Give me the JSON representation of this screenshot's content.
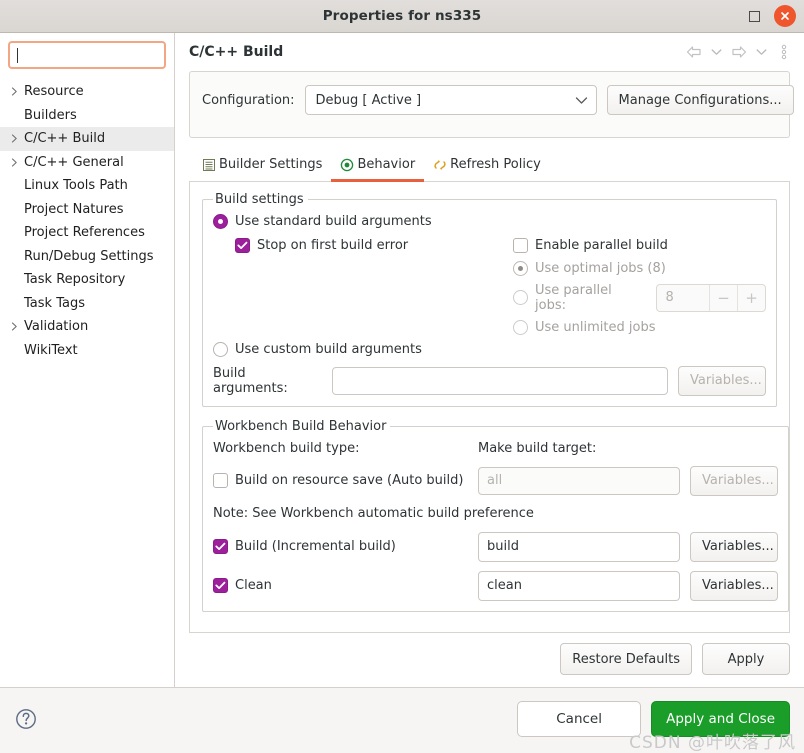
{
  "window": {
    "title": "Properties for ns335",
    "maximize_icon": "maximize-icon",
    "close_icon": "close-icon"
  },
  "sidebar": {
    "filter": {
      "value": "",
      "placeholder": ""
    },
    "items": [
      {
        "label": "Resource",
        "expandable": true,
        "selected": false
      },
      {
        "label": "Builders",
        "expandable": false,
        "selected": false
      },
      {
        "label": "C/C++ Build",
        "expandable": true,
        "selected": true
      },
      {
        "label": "C/C++ General",
        "expandable": true,
        "selected": false
      },
      {
        "label": "Linux Tools Path",
        "expandable": false,
        "selected": false
      },
      {
        "label": "Project Natures",
        "expandable": false,
        "selected": false
      },
      {
        "label": "Project References",
        "expandable": false,
        "selected": false
      },
      {
        "label": "Run/Debug Settings",
        "expandable": false,
        "selected": false
      },
      {
        "label": "Task Repository",
        "expandable": false,
        "selected": false
      },
      {
        "label": "Task Tags",
        "expandable": false,
        "selected": false
      },
      {
        "label": "Validation",
        "expandable": true,
        "selected": false
      },
      {
        "label": "WikiText",
        "expandable": false,
        "selected": false
      }
    ]
  },
  "header": {
    "title": "C/C++ Build",
    "tools": [
      "back-arrow-icon",
      "back-dropdown-chevron-icon",
      "forward-arrow-icon",
      "forward-dropdown-chevron-icon",
      "view-menu-icon"
    ]
  },
  "configuration": {
    "label": "Configuration:",
    "value": "Debug  [ Active ]",
    "manage_button": "Manage Configurations..."
  },
  "tabs": [
    {
      "label": "Builder Settings",
      "icon": "builder-settings-icon",
      "active": false
    },
    {
      "label": "Behavior",
      "icon": "behavior-icon",
      "active": true
    },
    {
      "label": "Refresh Policy",
      "icon": "refresh-policy-icon",
      "active": false
    }
  ],
  "build_settings": {
    "legend": "Build settings",
    "use_standard": {
      "label": "Use standard build arguments",
      "checked": true
    },
    "stop_on_first_error": {
      "label": "Stop on first build error",
      "checked": true
    },
    "enable_parallel": {
      "label": "Enable parallel build",
      "checked": false
    },
    "optimal_jobs": {
      "label": "Use optimal jobs (8)",
      "checked": true,
      "disabled": true
    },
    "parallel_jobs": {
      "label": "Use parallel jobs:",
      "checked": false,
      "disabled": true,
      "value": "8",
      "minus": "−",
      "plus": "+"
    },
    "unlimited_jobs": {
      "label": "Use unlimited jobs",
      "checked": false,
      "disabled": true
    },
    "use_custom": {
      "label": "Use custom build arguments",
      "checked": false
    },
    "build_arguments": {
      "label": "Build arguments:",
      "value": "",
      "variables_button": "Variables..."
    }
  },
  "workbench": {
    "legend": "Workbench Build Behavior",
    "build_type_label": "Workbench build type:",
    "make_target_label": "Make build target:",
    "rows": [
      {
        "label": "Build on resource save (Auto build)",
        "checked": false,
        "target": "",
        "target_placeholder": "all",
        "variables_button": "Variables...",
        "disabled": true
      },
      {
        "label": "Build (Incremental build)",
        "checked": true,
        "target": "build",
        "target_placeholder": "",
        "variables_button": "Variables...",
        "disabled": false
      },
      {
        "label": "Clean",
        "checked": true,
        "target": "clean",
        "target_placeholder": "",
        "variables_button": "Variables...",
        "disabled": false
      }
    ],
    "note": "Note: See Workbench automatic build preference"
  },
  "page_buttons": {
    "restore_defaults": "Restore Defaults",
    "apply": "Apply"
  },
  "bottom": {
    "help_icon": "help-icon",
    "cancel": "Cancel",
    "apply_and_close": "Apply and Close"
  },
  "watermark": "CSDN @叶吹落了风",
  "colors": {
    "accent_orange": "#e8613c",
    "focus_orange": "#f3a683",
    "control_purple": "#9c1f9c",
    "primary_green": "#1a9d29",
    "close_red": "#ef562d"
  }
}
